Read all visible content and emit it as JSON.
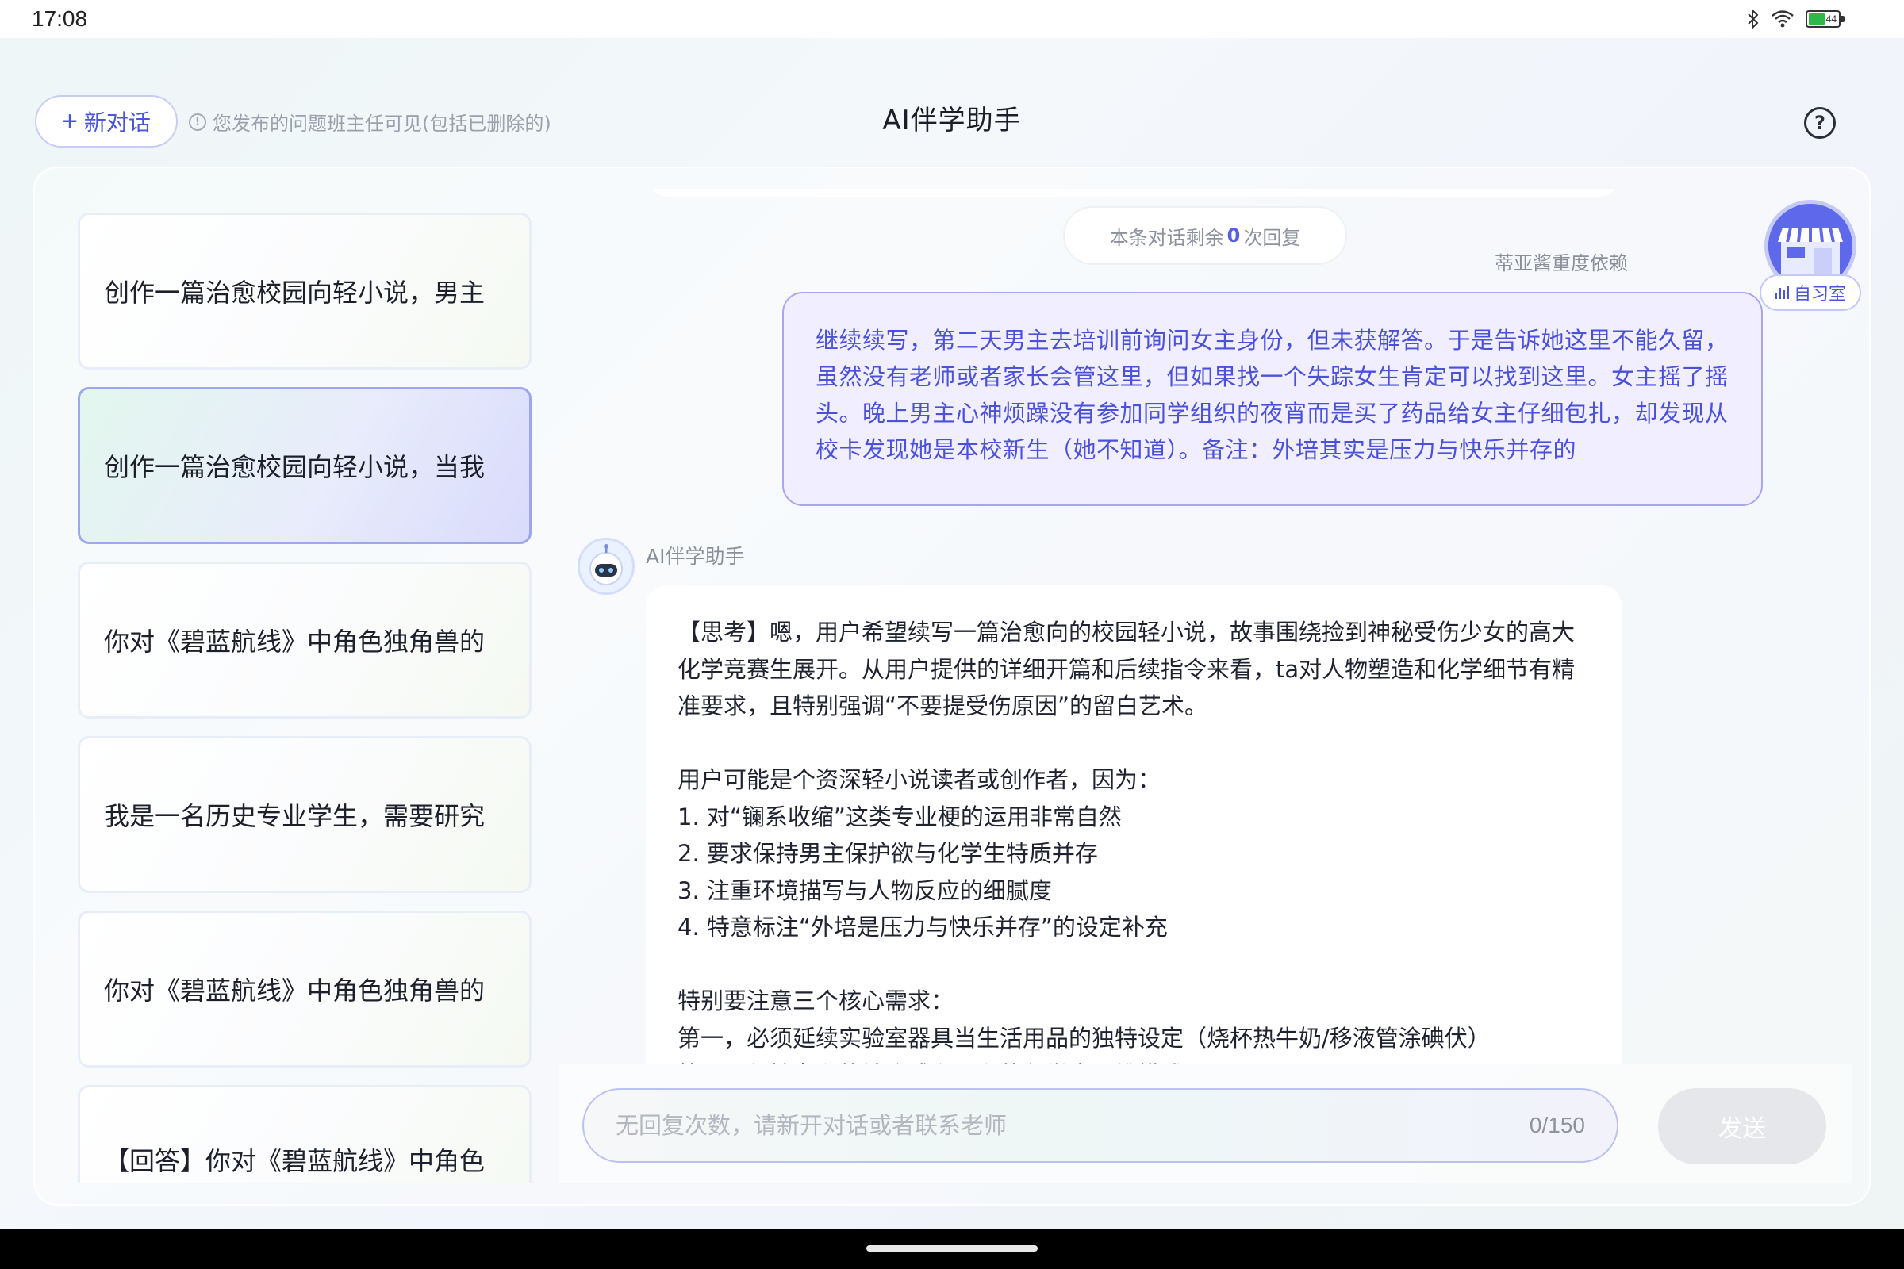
{
  "status_bar": {
    "time": "17:08",
    "battery_level": "44",
    "icons": [
      "bluetooth-icon",
      "wifi-icon",
      "battery-icon"
    ]
  },
  "header": {
    "new_chat_label": "新对话",
    "notice": "您发布的问题班主任可见(包括已删除的)",
    "title": "AI伴学助手"
  },
  "sidebar": {
    "conversations": [
      {
        "title": "创作一篇治愈校园向轻小说，男主",
        "active": false
      },
      {
        "title": "创作一篇治愈校园向轻小说，当我",
        "active": true
      },
      {
        "title": "你对《碧蓝航线》中角色独角兽的",
        "active": false
      },
      {
        "title": "我是一名历史专业学生，需要研究",
        "active": false
      },
      {
        "title": "你对《碧蓝航线》中角色独角兽的",
        "active": false
      },
      {
        "title": "【回答】你对《碧蓝航线》中角色",
        "active": false
      }
    ]
  },
  "chat": {
    "remaining": {
      "prefix": "本条对话剩余",
      "count": "0",
      "suffix": "次回复"
    },
    "user_name": "蒂亚酱重度依赖",
    "user_tag": "自习室",
    "user_message": "继续续写，第二天男主去培训前询问女主身份，但未获解答。于是告诉她这里不能久留，虽然没有老师或者家长会管这里，但如果找一个失踪女生肯定可以找到这里。女主摇了摇头。晚上男主心神烦躁没有参加同学组织的夜宵而是买了药品给女主仔细包扎，却发现从校卡发现她是本校新生（她不知道）。备注：外培其实是压力与快乐并存的",
    "bot_name": "AI伴学助手",
    "bot_paragraphs": [
      [
        "【思考】嗯，用户希望续写一篇治愈向的校园轻小说，故事围绕捡到神秘受伤少女的高大化学竞赛生展开。从用户提供的详细开篇和后续指令来看，ta对人物塑造和化学细节有精准要求，且特别强调“不要提受伤原因”的留白艺术。"
      ],
      [
        "用户可能是个资深轻小说读者或创作者，因为：",
        "1. 对“镧系收缩”这类专业梗的运用非常自然",
        "2. 要求保持男主保护欲与化学生特质并存",
        "3. 注重环境描写与人物反应的细腻度",
        "4. 特意标注“外培是压力与快乐并存”的设定补充"
      ],
      [
        "特别要注意三个核心需求：",
        "第一，必须延续实验室器具当生活用品的独特设定（烧杯热牛奶/移液管涂碘伏）",
        "第二，保持女主的神秘感和男主的化学生思维模式"
      ]
    ]
  },
  "composer": {
    "placeholder": "无回复次数，请新开对话或者联系老师",
    "counter": "0/150",
    "send_label": "发送"
  }
}
